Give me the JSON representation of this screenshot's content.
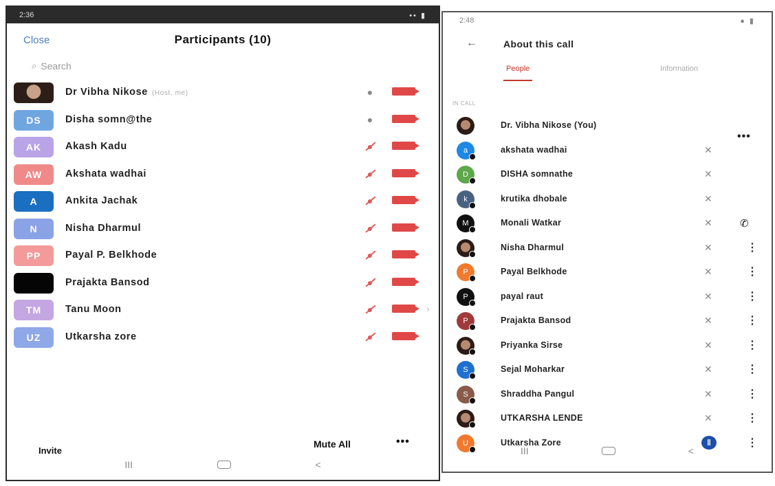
{
  "left": {
    "status_time": "2:36",
    "status_icons": "✉ ■",
    "status_right": "•• ▮",
    "close_label": "Close",
    "title": "Participants (10)",
    "search_placeholder": "Search",
    "participants": [
      {
        "initials": "",
        "name": "Dr Vibha Nikose",
        "tag": "(Host, me)",
        "avatar_color": "#2c1d16",
        "photo": true,
        "muted": false
      },
      {
        "initials": "DS",
        "name": "Disha somn@the",
        "tag": "",
        "avatar_color": "#6fa6e0",
        "photo": false,
        "muted": false
      },
      {
        "initials": "AK",
        "name": "Akash Kadu",
        "tag": "",
        "avatar_color": "#b8a4e6",
        "photo": false,
        "muted": true
      },
      {
        "initials": "AW",
        "name": "Akshata wadhai",
        "tag": "",
        "avatar_color": "#f08a8a",
        "photo": false,
        "muted": true
      },
      {
        "initials": "A",
        "name": "Ankita Jachak",
        "tag": "",
        "avatar_color": "#1a6fc0",
        "photo": false,
        "muted": true
      },
      {
        "initials": "N",
        "name": "Nisha Dharmul",
        "tag": "",
        "avatar_color": "#8aa2e6",
        "photo": false,
        "muted": true
      },
      {
        "initials": "PP",
        "name": "Payal P. Belkhode",
        "tag": "",
        "avatar_color": "#f39a9a",
        "photo": false,
        "muted": true
      },
      {
        "initials": "",
        "name": "Prajakta Bansod",
        "tag": "",
        "avatar_color": "#050505",
        "photo": false,
        "muted": true
      },
      {
        "initials": "TM",
        "name": "Tanu Moon",
        "tag": "",
        "avatar_color": "#c4a6e2",
        "photo": false,
        "muted": true
      },
      {
        "initials": "UZ",
        "name": "Utkarsha zore",
        "tag": "",
        "avatar_color": "#8ea8e8",
        "photo": false,
        "muted": true
      }
    ],
    "invite_label": "Invite",
    "mute_all_label": "Mute All",
    "more_label": "•••",
    "nav_recents": "III",
    "nav_back": "<"
  },
  "right": {
    "status_time": "2:48",
    "status_right": "● ▮",
    "title": "About this call",
    "tab_people": "People",
    "tab_information": "Information",
    "in_call_label": "IN CALL",
    "more_label": "•••",
    "members": [
      {
        "initial": "",
        "name": "Dr. Vibha Nikose (You)",
        "color": "#2b1c15",
        "photo": true,
        "mute": "",
        "kebab": false
      },
      {
        "initial": "a",
        "name": "akshata wadhai",
        "color": "#1e88e5",
        "photo": false,
        "mute": "muted",
        "kebab": false
      },
      {
        "initial": "D",
        "name": "DISHA somnathe",
        "color": "#5da84a",
        "photo": false,
        "mute": "muted",
        "kebab": false
      },
      {
        "initial": "k",
        "name": "krutika dhobale",
        "color": "#4a6282",
        "photo": false,
        "mute": "muted",
        "kebab": false
      },
      {
        "initial": "M",
        "name": "Monali Watkar",
        "color": "#111111",
        "photo": false,
        "mute": "muted",
        "kebab": false
      },
      {
        "initial": "",
        "name": "Nisha Dharmul",
        "color": "#6a2a2a",
        "photo": true,
        "mute": "muted",
        "kebab": true
      },
      {
        "initial": "P",
        "name": "Payal Belkhode",
        "color": "#ef7a2e",
        "photo": false,
        "mute": "muted",
        "kebab": true
      },
      {
        "initial": "P",
        "name": "payal raut",
        "color": "#111111",
        "photo": false,
        "mute": "muted",
        "kebab": true
      },
      {
        "initial": "P",
        "name": "Prajakta Bansod",
        "color": "#a03a3a",
        "photo": false,
        "mute": "muted",
        "kebab": true
      },
      {
        "initial": "",
        "name": "Priyanka Sirse",
        "color": "#4a2a1a",
        "photo": true,
        "mute": "muted",
        "kebab": true
      },
      {
        "initial": "S",
        "name": "Sejal Moharkar",
        "color": "#1e6fd0",
        "photo": false,
        "mute": "muted",
        "kebab": true
      },
      {
        "initial": "S",
        "name": "Shraddha Pangul",
        "color": "#8a5a4a",
        "photo": false,
        "mute": "muted",
        "kebab": true
      },
      {
        "initial": "",
        "name": "UTKARSHA LENDE",
        "color": "#3a2418",
        "photo": true,
        "mute": "muted",
        "kebab": true
      },
      {
        "initial": "U",
        "name": "Utkarsha Zore",
        "color": "#ef7a2e",
        "photo": false,
        "mute": "speaking",
        "kebab": true
      }
    ],
    "speaking_glyph": "‖",
    "mute_glyph": "✕",
    "nav_recents": "III",
    "nav_back": "<"
  }
}
